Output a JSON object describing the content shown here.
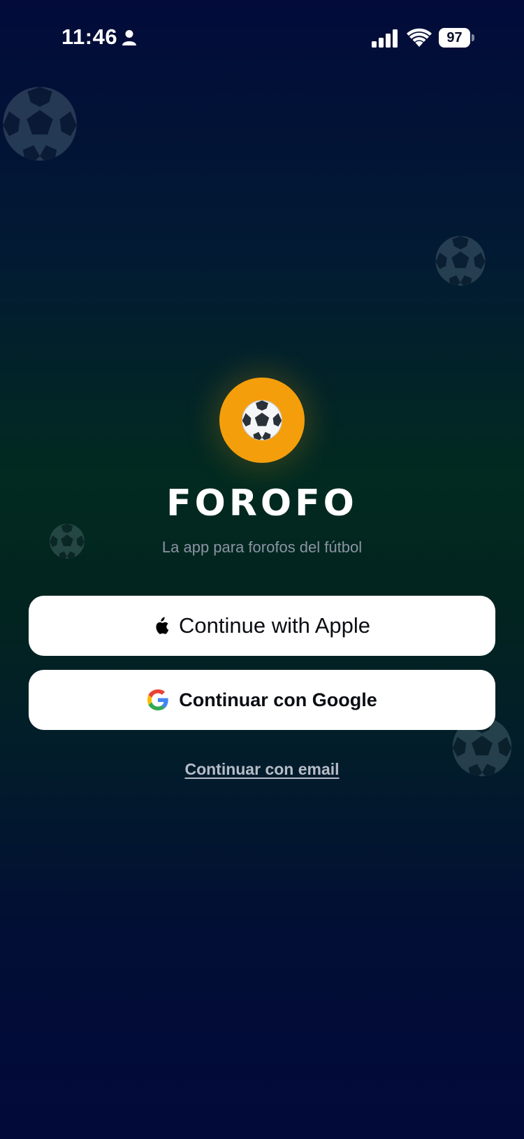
{
  "status_bar": {
    "time": "11:46",
    "battery_level": "97",
    "icons": [
      "person-icon",
      "signal-icon",
      "wifi-icon",
      "battery-icon"
    ]
  },
  "logo": {
    "icon": "soccer-ball-icon",
    "accent_color": "#f59e0b"
  },
  "app": {
    "title": "FOROFO",
    "tagline": "La app para forofos del fútbol"
  },
  "auth": {
    "apple_label": "Continue with Apple",
    "google_label": "Continuar con Google",
    "email_label": "Continuar con email"
  },
  "colors": {
    "background_top": "#020b3a",
    "background_mid": "#022a20",
    "button_bg": "#ffffff",
    "tagline": "#8b93a3"
  }
}
